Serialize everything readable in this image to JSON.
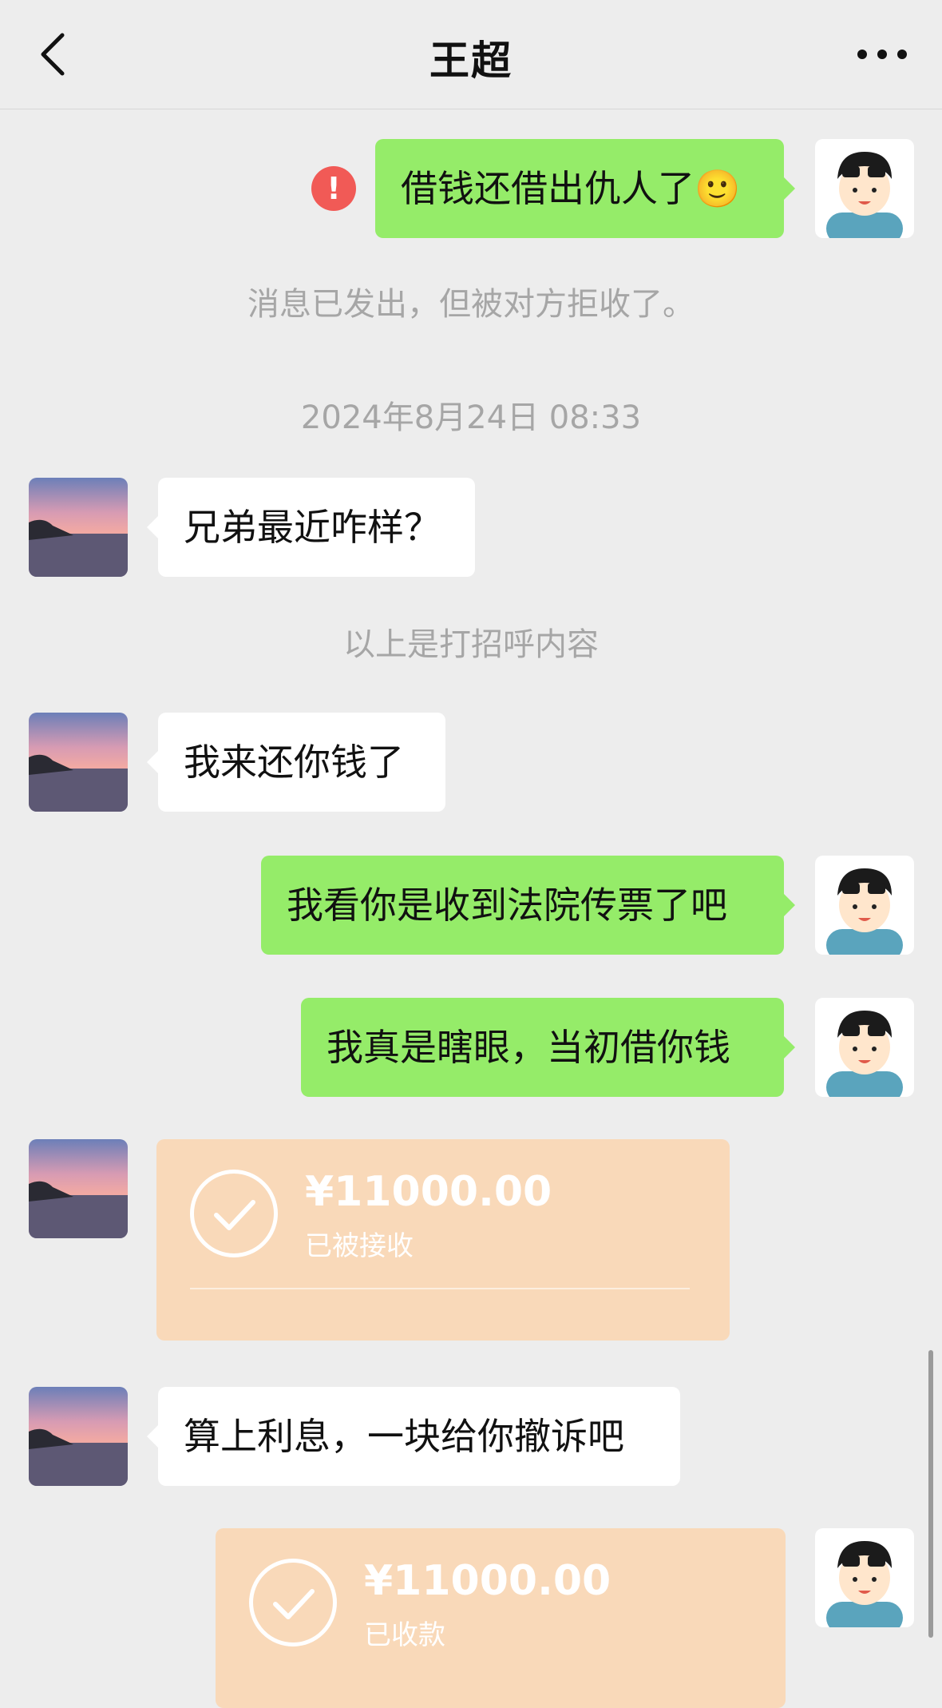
{
  "header": {
    "title": "王超",
    "back_icon": "chevron-left-icon",
    "more_icon": "more-dots-icon"
  },
  "messages": {
    "m1": {
      "text": "借钱还借出仇人了",
      "emoji": "🙂"
    },
    "rejected_notice": "消息已发出，但被对方拒收了。",
    "timestamp": "2024年8月24日 08:33",
    "m2": {
      "text": "兄弟最近咋样？"
    },
    "greeting_notice": "以上是打招呼内容",
    "m3": {
      "text": "我来还你钱了"
    },
    "m4": {
      "text": "我看你是收到法院传票了吧"
    },
    "m5": {
      "text": "我真是瞎眼，当初借你钱"
    },
    "transfer1": {
      "amount": "¥11000.00",
      "status": "已被接收"
    },
    "m6": {
      "text": "算上利息，一块给你撤诉吧"
    },
    "transfer2": {
      "amount": "¥11000.00",
      "status": "已收款"
    }
  },
  "colors": {
    "background": "#ededed",
    "outgoing_bubble": "#95ec69",
    "incoming_bubble": "#ffffff",
    "transfer_card": "#f9d9b9",
    "error_badge": "#f15a56",
    "system_text": "#a6a6a6"
  }
}
